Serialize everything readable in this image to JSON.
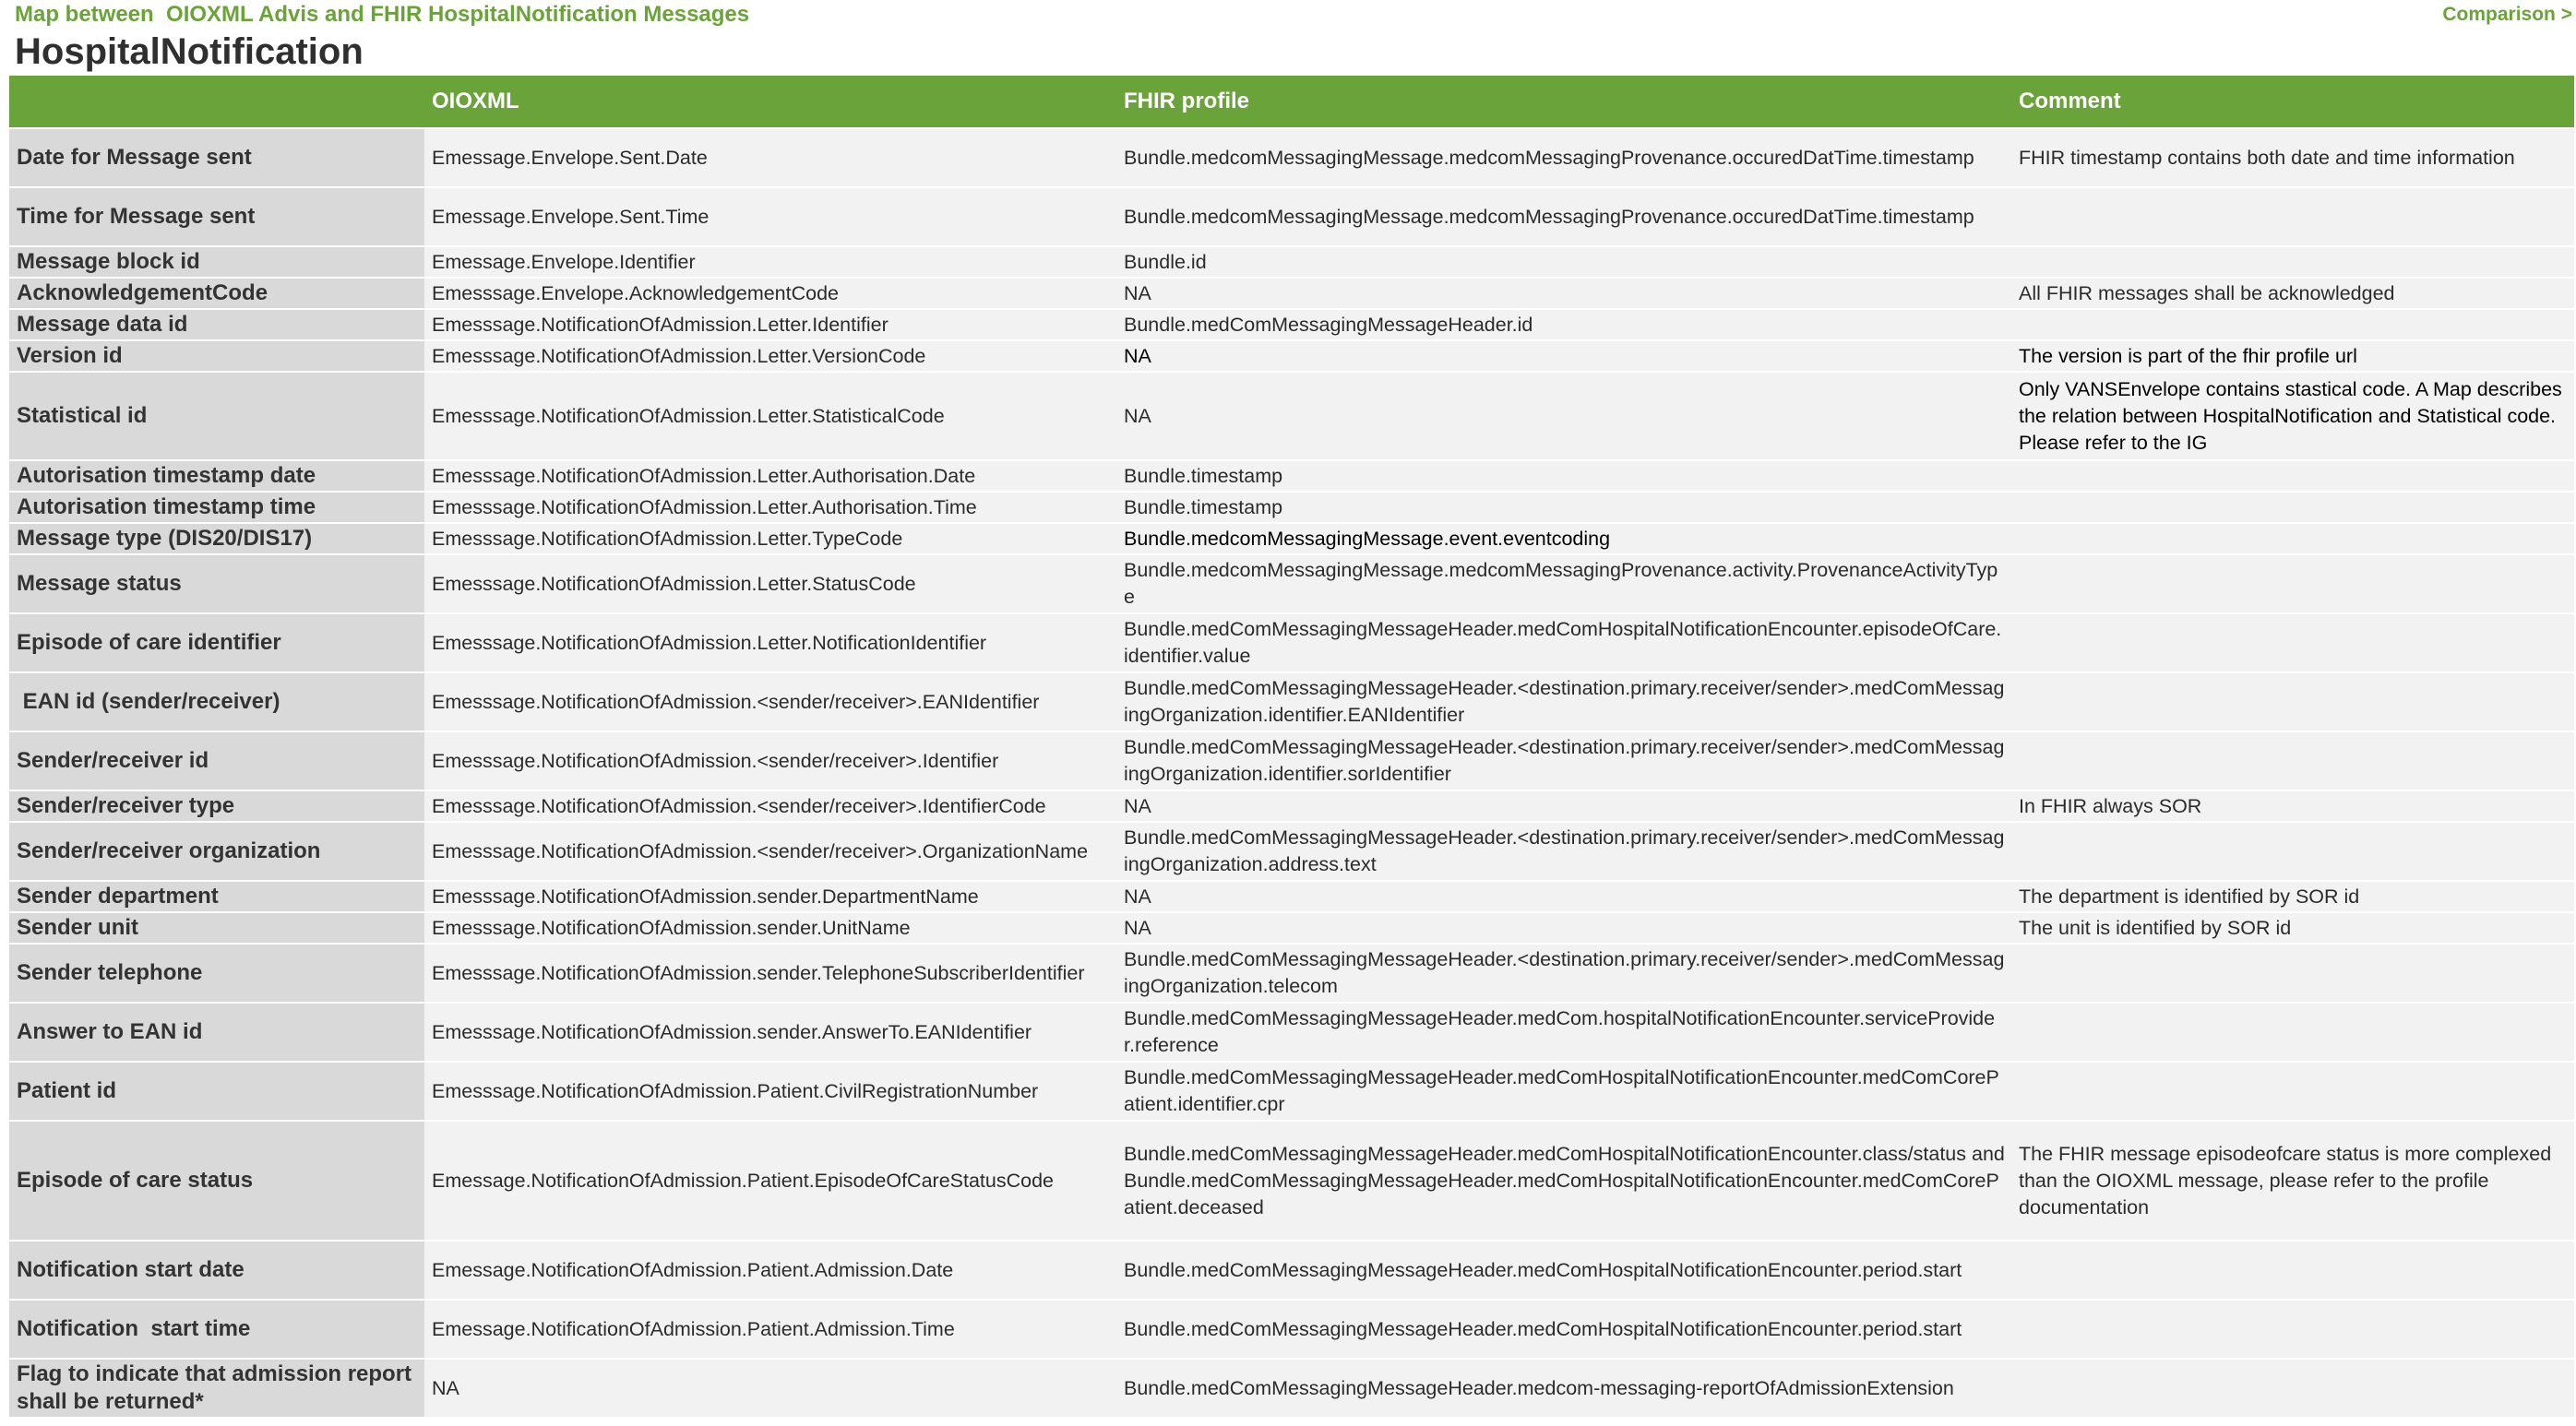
{
  "header": {
    "breadcrumb": "Map between  OIOXML Advis and FHIR HospitalNotification Messages",
    "nav_link": "Comparison >",
    "title": "HospitalNotification"
  },
  "colors": {
    "accent": "#6aa339",
    "row_bg": "#f2f2f2",
    "label_bg": "#d9d9d9"
  },
  "table": {
    "columns": [
      "",
      "OIOXML",
      "FHIR profile",
      "Comment"
    ],
    "rows": [
      {
        "label": "Date for Message sent",
        "oioxml": "Emessage.Envelope.Sent.Date",
        "fhir": "Bundle.medcomMessagingMessage.medcomMessagingProvenance.occuredDatTime.timestamp",
        "comment": "FHIR timestamp contains both date and time information"
      },
      {
        "label": "Time for Message sent",
        "oioxml": "Emessage.Envelope.Sent.Time",
        "fhir": "Bundle.medcomMessagingMessage.medcomMessagingProvenance.occuredDatTime.timestamp",
        "comment": ""
      },
      {
        "label": "Message block id",
        "oioxml": "Emessage.Envelope.Identifier",
        "fhir": "Bundle.id",
        "comment": ""
      },
      {
        "label": "AcknowledgementCode",
        "oioxml": "Emesssage.Envelope.AcknowledgementCode",
        "fhir": "NA",
        "comment": "All FHIR messages shall be acknowledged"
      },
      {
        "label": "Message data id",
        "oioxml": "Emesssage.NotificationOfAdmission.Letter.Identifier",
        "fhir": "Bundle.medComMessagingMessageHeader.id",
        "comment": ""
      },
      {
        "label": "Version id",
        "oioxml": "Emesssage.NotificationOfAdmission.Letter.VersionCode",
        "fhir": "NA",
        "comment": "The version is part of the fhir profile url"
      },
      {
        "label": "Statistical id",
        "oioxml": "Emesssage.NotificationOfAdmission.Letter.StatisticalCode",
        "fhir": "NA",
        "comment": "Only VANSEnvelope contains stastical code. A Map describes the relation between HospitalNotification and Statistical code. Please refer to the IG"
      },
      {
        "label": "Autorisation timestamp date",
        "oioxml": "Emesssage.NotificationOfAdmission.Letter.Authorisation.Date",
        "fhir": "Bundle.timestamp",
        "comment": ""
      },
      {
        "label": "Autorisation timestamp time",
        "oioxml": "Emesssage.NotificationOfAdmission.Letter.Authorisation.Time",
        "fhir": "Bundle.timestamp",
        "comment": ""
      },
      {
        "label": "Message type (DIS20/DIS17)",
        "oioxml": "Emesssage.NotificationOfAdmission.Letter.TypeCode",
        "fhir": "Bundle.medcomMessagingMessage.event.eventcoding",
        "comment": ""
      },
      {
        "label": "Message status",
        "oioxml": "Emesssage.NotificationOfAdmission.Letter.StatusCode",
        "fhir": "Bundle.medcomMessagingMessage.medcomMessagingProvenance.activity.ProvenanceActivityType",
        "comment": ""
      },
      {
        "label": "Episode of care identifier",
        "oioxml": "Emesssage.NotificationOfAdmission.Letter.NotificationIdentifier",
        "fhir": "Bundle.medComMessagingMessageHeader.medComHospitalNotificationEncounter.episodeOfCare.identifier.value",
        "comment": ""
      },
      {
        "label": " EAN id (sender/receiver)",
        "oioxml": "Emesssage.NotificationOfAdmission.<sender/receiver>.EANIdentifier",
        "fhir": "Bundle.medComMessagingMessageHeader.<destination.primary.receiver/sender>.medComMessagingOrganization.identifier.EANIdentifier",
        "comment": ""
      },
      {
        "label": "Sender/receiver id",
        "oioxml": "Emesssage.NotificationOfAdmission.<sender/receiver>.Identifier",
        "fhir": "Bundle.medComMessagingMessageHeader.<destination.primary.receiver/sender>.medComMessagingOrganization.identifier.sorIdentifier",
        "comment": ""
      },
      {
        "label": "Sender/receiver type",
        "oioxml": "Emesssage.NotificationOfAdmission.<sender/receiver>.IdentifierCode",
        "fhir": "NA",
        "comment": "In FHIR always SOR"
      },
      {
        "label": "Sender/receiver organization",
        "oioxml": "Emesssage.NotificationOfAdmission.<sender/receiver>.OrganizationName",
        "fhir": "Bundle.medComMessagingMessageHeader.<destination.primary.receiver/sender>.medComMessagingOrganization.address.text",
        "comment": ""
      },
      {
        "label": "Sender department",
        "oioxml": "Emesssage.NotificationOfAdmission.sender.DepartmentName",
        "fhir": "NA",
        "comment": "The department is identified by SOR id"
      },
      {
        "label": "Sender unit",
        "oioxml": "Emesssage.NotificationOfAdmission.sender.UnitName",
        "fhir": "NA",
        "comment": "The unit  is identified by SOR id"
      },
      {
        "label": "Sender telephone",
        "oioxml": "Emesssage.NotificationOfAdmission.sender.TelephoneSubscriberIdentifier",
        "fhir": "Bundle.medComMessagingMessageHeader.<destination.primary.receiver/sender>.medComMessagingOrganization.telecom",
        "comment": ""
      },
      {
        "label": "Answer to EAN id",
        "oioxml": "Emesssage.NotificationOfAdmission.sender.AnswerTo.EANIdentifier",
        "fhir": "Bundle.medComMessagingMessageHeader.medCom.hospitalNotificationEncounter.serviceProvider.reference",
        "comment": ""
      },
      {
        "label": "Patient id",
        "oioxml": "Emesssage.NotificationOfAdmission.Patient.CivilRegistrationNumber",
        "fhir": "Bundle.medComMessagingMessageHeader.medComHospitalNotificationEncounter.medComCorePatient.identifier.cpr",
        "comment": ""
      },
      {
        "label": "Episode of care status",
        "oioxml": "Emessage.NotificationOfAdmission.Patient.EpisodeOfCareStatusCode",
        "fhir": "Bundle.medComMessagingMessageHeader.medComHospitalNotificationEncounter.class/status and Bundle.medComMessagingMessageHeader.medComHospitalNotificationEncounter.medComCorePatient.deceased",
        "comment": "The FHIR message episodeofcare status is more complexed than the OIOXML message, please refer to the profile documentation"
      },
      {
        "label": "Notification start date",
        "oioxml": "Emessage.NotificationOfAdmission.Patient.Admission.Date",
        "fhir": "Bundle.medComMessagingMessageHeader.medComHospitalNotificationEncounter.period.start",
        "comment": ""
      },
      {
        "label": "Notification  start time",
        "oioxml": "Emessage.NotificationOfAdmission.Patient.Admission.Time",
        "fhir": "Bundle.medComMessagingMessageHeader.medComHospitalNotificationEncounter.period.start",
        "comment": ""
      },
      {
        "label": "Flag to indicate that admission report shall be returned*",
        "oioxml": "NA",
        "fhir": "Bundle.medComMessagingMessageHeader.medcom-messaging-reportOfAdmissionExtension",
        "comment": ""
      }
    ]
  }
}
